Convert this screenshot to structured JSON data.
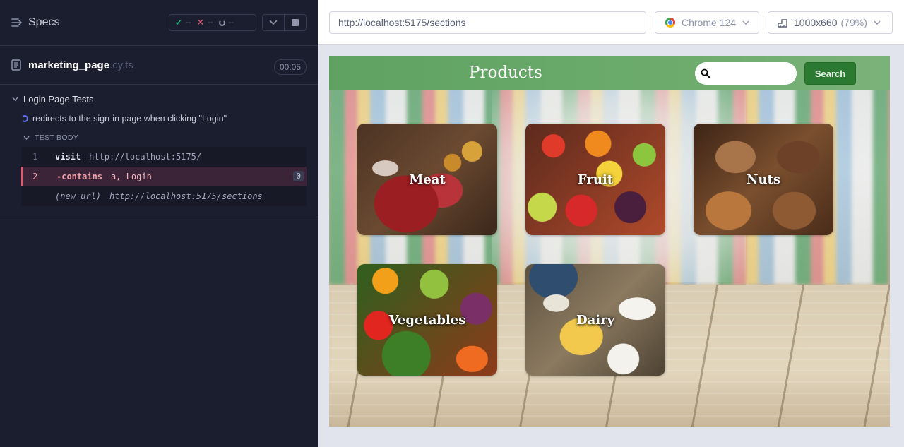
{
  "reporter": {
    "header": {
      "title": "Specs",
      "passed": "--",
      "failed": "--",
      "pending": "--"
    },
    "spec": {
      "name": "marketing_page",
      "ext": ".cy.ts",
      "duration": "00:05"
    },
    "suite": {
      "title": "Login Page Tests",
      "test_title": "redirects to the sign-in page when clicking \"Login\"",
      "body_label": "TEST BODY",
      "commands": [
        {
          "num": "1",
          "name": "visit",
          "arg": "http://localhost:5175/"
        },
        {
          "num": "2",
          "name": "-contains",
          "arg": "a, Login",
          "badge": "0"
        },
        {
          "label": "(new url)",
          "arg": "http://localhost:5175/sections"
        }
      ]
    }
  },
  "browser": {
    "url": "http://localhost:5175/sections",
    "browser_name": "Chrome 124",
    "viewport": "1000x660",
    "scale": "(79%)"
  },
  "app": {
    "title": "Products",
    "search_placeholder": "",
    "search_button": "Search",
    "categories": [
      {
        "label": "Meat"
      },
      {
        "label": "Fruit"
      },
      {
        "label": "Nuts"
      },
      {
        "label": "Vegetables"
      },
      {
        "label": "Dairy"
      }
    ]
  },
  "colors": {
    "reporter_bg": "#1b1e2e",
    "fail_red": "#e45770",
    "pass_green": "#1fa971",
    "app_header_green": "#6cab6b",
    "search_button_green": "#2c7a32"
  }
}
